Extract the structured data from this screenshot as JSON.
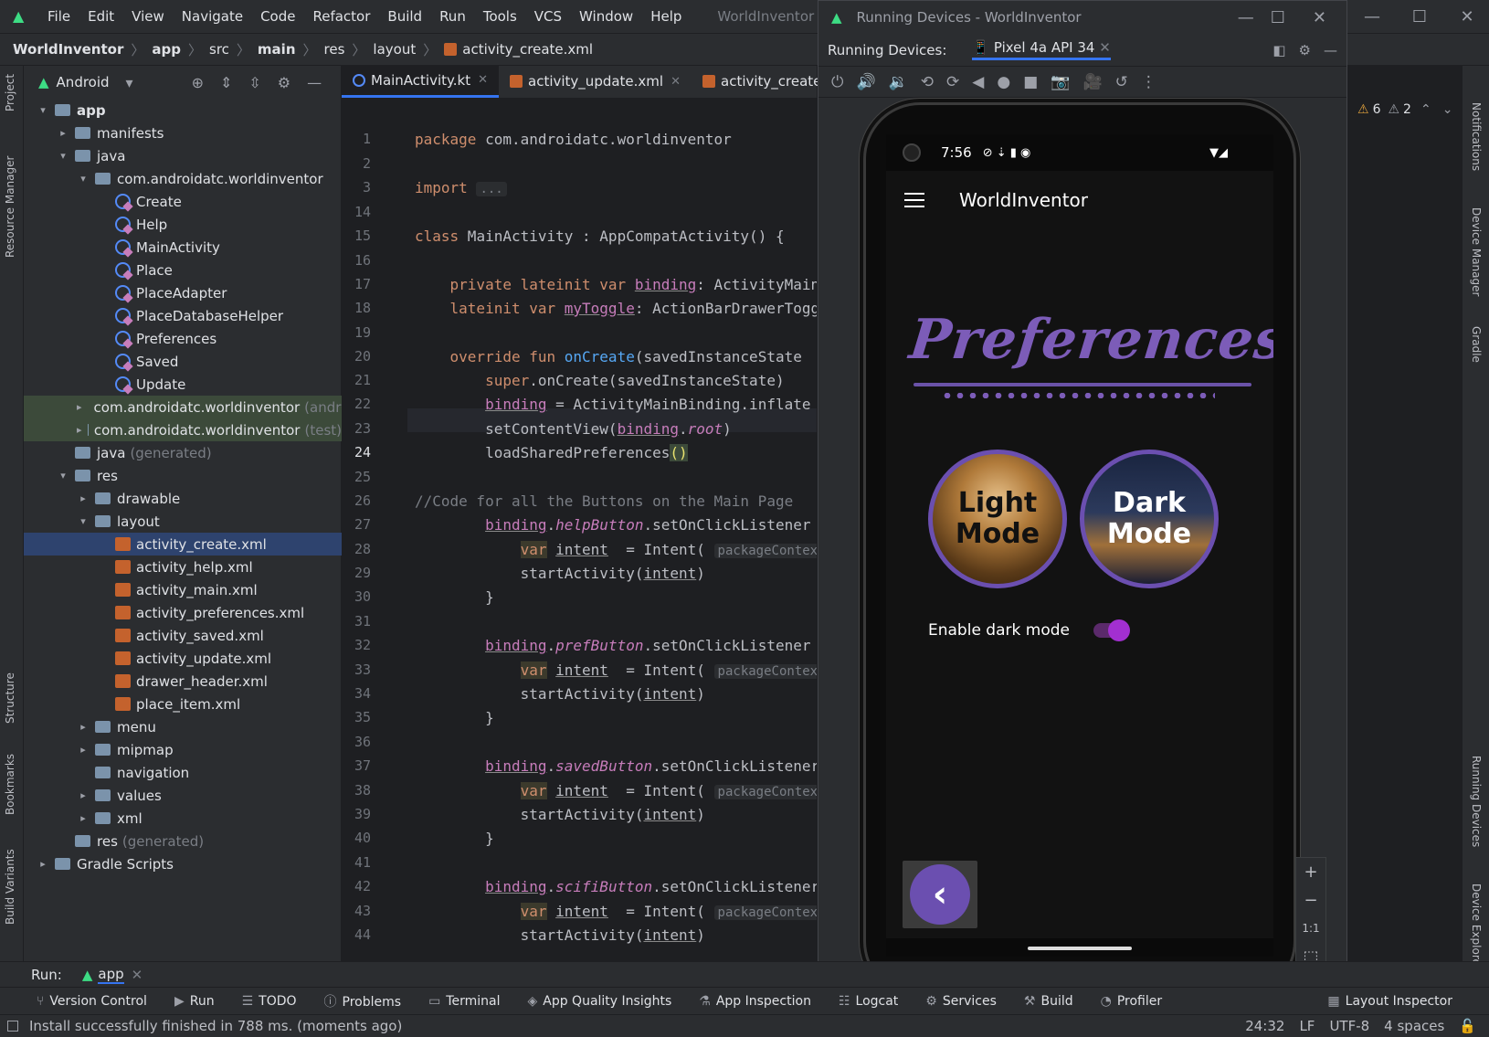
{
  "menu": {
    "items": [
      "File",
      "Edit",
      "View",
      "Navigate",
      "Code",
      "Refactor",
      "Build",
      "Run",
      "Tools",
      "VCS",
      "Window",
      "Help"
    ],
    "window_title": "WorldInventor - MainActivit"
  },
  "breadcrumb": {
    "items": [
      "WorldInventor",
      "app",
      "src",
      "main",
      "res",
      "layout",
      "activity_create.xml"
    ]
  },
  "project_panel": {
    "view_mode": "Android",
    "tree": [
      {
        "label": "app",
        "depth": 0,
        "arrow": "v",
        "icon": "folder",
        "bold": true
      },
      {
        "label": "manifests",
        "depth": 1,
        "arrow": ">",
        "icon": "folder"
      },
      {
        "label": "java",
        "depth": 1,
        "arrow": "v",
        "icon": "folder"
      },
      {
        "label": "com.androidatc.worldinventor",
        "depth": 2,
        "arrow": "v",
        "icon": "folder"
      },
      {
        "label": "Create",
        "depth": 3,
        "arrow": "",
        "icon": "kotlin"
      },
      {
        "label": "Help",
        "depth": 3,
        "arrow": "",
        "icon": "kotlin"
      },
      {
        "label": "MainActivity",
        "depth": 3,
        "arrow": "",
        "icon": "kotlin"
      },
      {
        "label": "Place",
        "depth": 3,
        "arrow": "",
        "icon": "kotlin"
      },
      {
        "label": "PlaceAdapter",
        "depth": 3,
        "arrow": "",
        "icon": "kotlin"
      },
      {
        "label": "PlaceDatabaseHelper",
        "depth": 3,
        "arrow": "",
        "icon": "kotlin"
      },
      {
        "label": "Preferences",
        "depth": 3,
        "arrow": "",
        "icon": "kotlin"
      },
      {
        "label": "Saved",
        "depth": 3,
        "arrow": "",
        "icon": "kotlin"
      },
      {
        "label": "Update",
        "depth": 3,
        "arrow": "",
        "icon": "kotlin"
      },
      {
        "label": "com.androidatc.worldinventor",
        "suffix": "(andro",
        "depth": 2,
        "arrow": ">",
        "icon": "folder",
        "green": true
      },
      {
        "label": "com.androidatc.worldinventor",
        "suffix": "(test)",
        "depth": 2,
        "arrow": ">",
        "icon": "folder",
        "green": true
      },
      {
        "label": "java",
        "suffix": "(generated)",
        "depth": 1,
        "arrow": "",
        "icon": "folder"
      },
      {
        "label": "res",
        "depth": 1,
        "arrow": "v",
        "icon": "folder"
      },
      {
        "label": "drawable",
        "depth": 2,
        "arrow": ">",
        "icon": "folder"
      },
      {
        "label": "layout",
        "depth": 2,
        "arrow": "v",
        "icon": "folder"
      },
      {
        "label": "activity_create.xml",
        "depth": 3,
        "arrow": "",
        "icon": "xml",
        "selected": true
      },
      {
        "label": "activity_help.xml",
        "depth": 3,
        "arrow": "",
        "icon": "xml"
      },
      {
        "label": "activity_main.xml",
        "depth": 3,
        "arrow": "",
        "icon": "xml"
      },
      {
        "label": "activity_preferences.xml",
        "depth": 3,
        "arrow": "",
        "icon": "xml"
      },
      {
        "label": "activity_saved.xml",
        "depth": 3,
        "arrow": "",
        "icon": "xml"
      },
      {
        "label": "activity_update.xml",
        "depth": 3,
        "arrow": "",
        "icon": "xml"
      },
      {
        "label": "drawer_header.xml",
        "depth": 3,
        "arrow": "",
        "icon": "xml"
      },
      {
        "label": "place_item.xml",
        "depth": 3,
        "arrow": "",
        "icon": "xml"
      },
      {
        "label": "menu",
        "depth": 2,
        "arrow": ">",
        "icon": "folder"
      },
      {
        "label": "mipmap",
        "depth": 2,
        "arrow": ">",
        "icon": "folder"
      },
      {
        "label": "navigation",
        "depth": 2,
        "arrow": "",
        "icon": "folder"
      },
      {
        "label": "values",
        "depth": 2,
        "arrow": ">",
        "icon": "folder"
      },
      {
        "label": "xml",
        "depth": 2,
        "arrow": ">",
        "icon": "folder"
      },
      {
        "label": "res",
        "suffix": "(generated)",
        "depth": 1,
        "arrow": "",
        "icon": "folder"
      },
      {
        "label": "Gradle Scripts",
        "depth": 0,
        "arrow": ">",
        "icon": "gradle"
      }
    ]
  },
  "left_strip": [
    "Project",
    "Resource Manager",
    "Structure",
    "Bookmarks",
    "Build Variants"
  ],
  "editor": {
    "tabs": [
      {
        "label": "MainActivity.kt",
        "active": true
      },
      {
        "label": "activity_update.xml",
        "active": false
      },
      {
        "label": "activity_create.xml",
        "active": false
      }
    ],
    "current_line": "24",
    "line_numbers": [
      "1",
      "2",
      "3",
      "14",
      "15",
      "16",
      "17",
      "18",
      "19",
      "20",
      "21",
      "22",
      "23",
      "24",
      "25",
      "26",
      "27",
      "28",
      "29",
      "30",
      "31",
      "32",
      "33",
      "34",
      "35",
      "36",
      "37",
      "38",
      "39",
      "40",
      "41",
      "42",
      "43",
      "44"
    ]
  },
  "running_devices": {
    "title": "Running Devices - WorldInventor",
    "label": "Running Devices:",
    "device_tab": "Pixel 4a API 34",
    "warnings": "6",
    "weak_warnings": "2",
    "zoom_controls": [
      "+",
      "−",
      "1:1"
    ]
  },
  "phone": {
    "time": "7:56",
    "app_title": "WorldInventor",
    "header_text": "Preferences",
    "light_button": "Light Mode",
    "dark_button": "Dark Mode",
    "dark_mode_label": "Enable dark mode",
    "dark_mode_enabled": true,
    "accent_color": "#6b4fb0"
  },
  "right_strip": [
    "Notifications",
    "Device Manager",
    "Gradle",
    "Running Devices",
    "Device Explorer"
  ],
  "run_bar": {
    "label": "Run:",
    "config": "app"
  },
  "tool_windows": [
    "Version Control",
    "Run",
    "TODO",
    "Problems",
    "Terminal",
    "App Quality Insights",
    "App Inspection",
    "Logcat",
    "Services",
    "Build",
    "Profiler",
    "Layout Inspector"
  ],
  "status": {
    "message": "Install successfully finished in 788 ms. (moments ago)",
    "position": "24:32",
    "line_sep": "LF",
    "encoding": "UTF-8",
    "indent": "4 spaces"
  }
}
